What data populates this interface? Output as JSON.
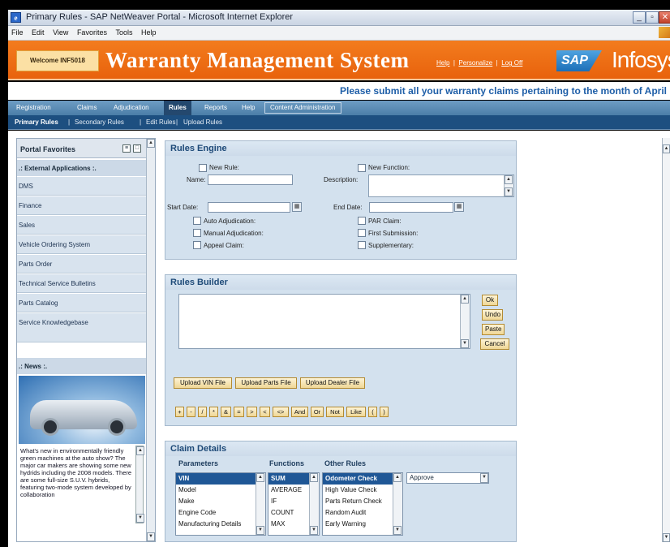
{
  "window": {
    "title": "Primary Rules - SAP NetWeaver Portal - Microsoft Internet Explorer",
    "icon": "ie-icon"
  },
  "menubar": [
    "File",
    "Edit",
    "View",
    "Favorites",
    "Tools",
    "Help"
  ],
  "header": {
    "welcome": "Welcome INF5018",
    "app_title": "Warranty Management System",
    "links": [
      "Help",
      "Personalize",
      "Log Off"
    ],
    "sap_logo": "SAP",
    "infosys_logo": "Infosys"
  },
  "banner": {
    "message": "Please submit all your warranty claims pertaining to the month of April"
  },
  "tabs": [
    "Registration",
    "Claims",
    "Adjudication",
    "Rules",
    "Reports",
    "Help",
    "Content Administration"
  ],
  "active_tab": "Rules",
  "subtabs": [
    "Primary Rules",
    "Secondary Rules",
    "Edit Rules",
    "Upload Rules"
  ],
  "leftnav": {
    "favorites_title": "Portal Favorites",
    "external_heading": ".: External Applications :.",
    "items": [
      "DMS",
      "Finance",
      "Sales",
      "Vehicle Ordering System",
      "Parts Order",
      "Technical Service Bulletins",
      "Parts Catalog",
      "Service Knowledgebase"
    ],
    "news_heading": ".: News :.",
    "news_text": "What's new in environmentally friendly green machines at the auto show? The major car makers are showing some new hydrids including the 2008 models. There are some full-size S.U.V. hybrids, featuring two-mode system developed by collaboration"
  },
  "rules_engine": {
    "title": "Rules Engine",
    "new_rule": "New Rule:",
    "new_function": "New Function:",
    "name_label": "Name:",
    "description_label": "Description:",
    "start_date_label": "Start Date:",
    "end_date_label": "End Date:",
    "left_checks": [
      "Auto Adjudication:",
      "Manual Adjudication:",
      "Appeal Claim:"
    ],
    "right_checks": [
      "PAR Claim:",
      "First Submission:",
      "Supplementary:"
    ]
  },
  "rules_builder": {
    "title": "Rules Builder",
    "side_buttons": [
      "Ok",
      "Undo",
      "Paste",
      "Cancel"
    ],
    "upload_buttons": [
      "Upload VIN File",
      "Upload Parts File",
      "Upload Dealer File"
    ],
    "operators": [
      "+",
      "-",
      "/",
      "*",
      "&",
      "=",
      ">",
      "<",
      "<>",
      "And",
      "Or",
      "Not",
      "Like",
      "(",
      ")"
    ]
  },
  "claim_details": {
    "title": "Claim Details",
    "parameters_label": "Parameters",
    "functions_label": "Functions",
    "other_rules_label": "Other Rules",
    "parameters": [
      "VIN",
      "Model",
      "Make",
      "Engine Code",
      "Manufacturing Details"
    ],
    "functions": [
      "SUM",
      "AVERAGE",
      "IF",
      "COUNT",
      "MAX"
    ],
    "other_rules": [
      "Odometer Check",
      "High Value Check",
      "Parts Return Check",
      "Random Audit",
      "Early Warning"
    ],
    "action_select": "Approve"
  }
}
